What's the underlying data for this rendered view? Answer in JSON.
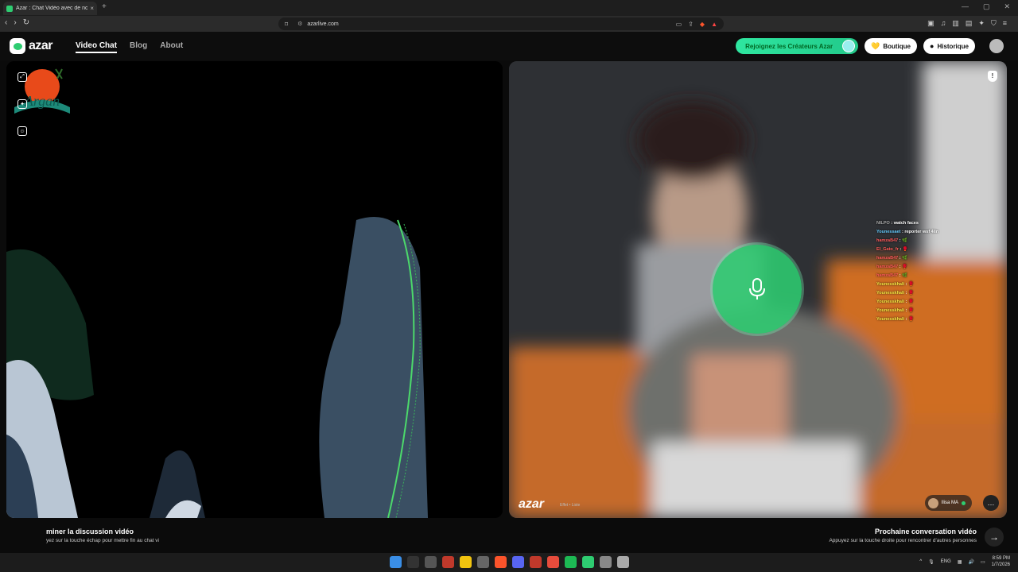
{
  "browser": {
    "tab_title": "Azar : Chat Vidéo avec de no",
    "tab_close": "×",
    "new_tab": "+",
    "url": "azarlive.com",
    "window_controls": [
      "—",
      "▢",
      "✕"
    ]
  },
  "site": {
    "logo_text": "azar",
    "nav": [
      "Video Chat",
      "Blog",
      "About"
    ],
    "creators_cta": "Rejoignez les Créateurs Azar",
    "shop_button": "Boutique",
    "history_button": "Historique"
  },
  "watermark": {
    "text": "Argan"
  },
  "right_panel": {
    "brand_watermark": "azar",
    "brand_sub": "Effet • Liste",
    "partner_name": "Ilisa",
    "partner_country": "MA",
    "chat_overlay": [
      {
        "user": "NILPO",
        "text": "watch faces",
        "color": "grey"
      },
      {
        "user": "Younessaet",
        "text": "reporter wsf 4lin",
        "color": "blue"
      },
      {
        "user": "hamzaB47",
        "text": "🌿",
        "color": "red"
      },
      {
        "user": "El_Gato_fr",
        "text": "🥊",
        "color": "red"
      },
      {
        "user": "hamzaB47",
        "text": "🌿",
        "color": "red"
      },
      {
        "user": "hamzaB47",
        "text": "🥊",
        "color": "red"
      },
      {
        "user": "hamzaB47",
        "text": "🌿",
        "color": "red"
      },
      {
        "user": "Younesskhali",
        "text": "🥊",
        "color": "yellow"
      },
      {
        "user": "Younesskhali",
        "text": "🥊",
        "color": "yellow"
      },
      {
        "user": "Younesskhali",
        "text": "🥊",
        "color": "yellow"
      },
      {
        "user": "Younesskhali",
        "text": "🥊",
        "color": "yellow"
      },
      {
        "user": "Younesskhali",
        "text": "🥊",
        "color": "yellow"
      }
    ]
  },
  "bottom": {
    "end_title": "miner la discussion vidéo",
    "end_hint": "yez sur la touche échap pour mettre fin au chat vi",
    "next_title": "Prochaine conversation vidéo",
    "next_hint": "Appuyez sur la touche droite pour rencontrer d'autres personnes",
    "next_icon": "→"
  },
  "taskbar": {
    "lang": "ENG",
    "time": "8:59 PM",
    "date": "1/7/2026"
  },
  "colors": {
    "accent": "#2ecc71",
    "cta_gradient_start": "#2fe6a0",
    "chat_blue": "#66ccff",
    "chat_red": "#ff5a5a",
    "chat_yellow": "#f5e642"
  }
}
